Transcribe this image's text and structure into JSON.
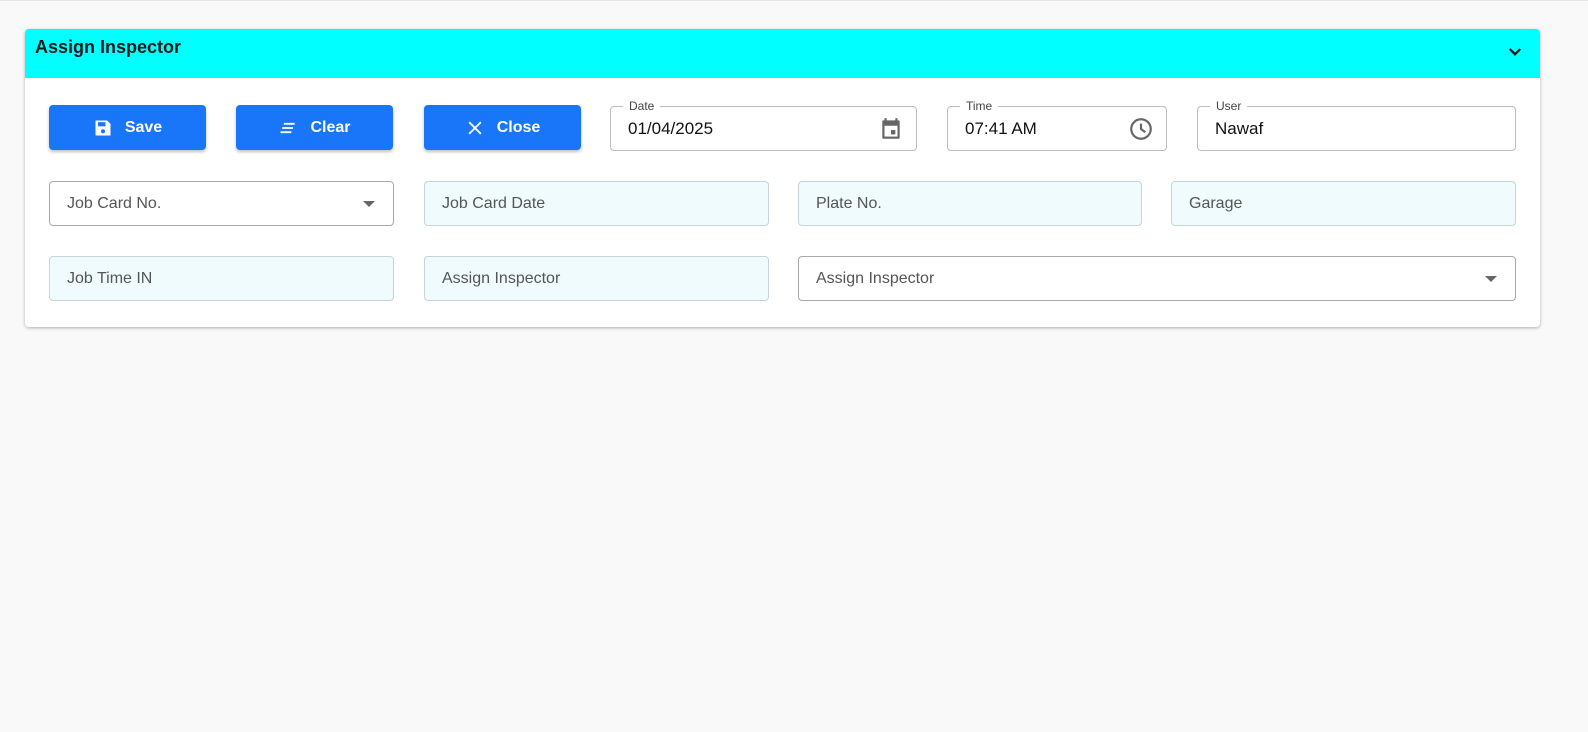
{
  "panel": {
    "title": "Assign Inspector"
  },
  "toolbar": {
    "save_label": "Save",
    "clear_label": "Clear",
    "close_label": "Close"
  },
  "fields": {
    "date": {
      "label": "Date",
      "value": "01/04/2025"
    },
    "time": {
      "label": "Time",
      "value": "07:41 AM"
    },
    "user": {
      "label": "User",
      "value": "Nawaf"
    },
    "job_card_no": "Job Card No.",
    "job_card_date": "Job Card Date",
    "plate_no": "Plate No.",
    "garage": "Garage",
    "job_time_in": "Job Time IN",
    "assign_inspector_text": "Assign Inspector",
    "assign_inspector_select": "Assign Inspector"
  },
  "colors": {
    "header": "#00ffff",
    "button": "#1976f8"
  }
}
